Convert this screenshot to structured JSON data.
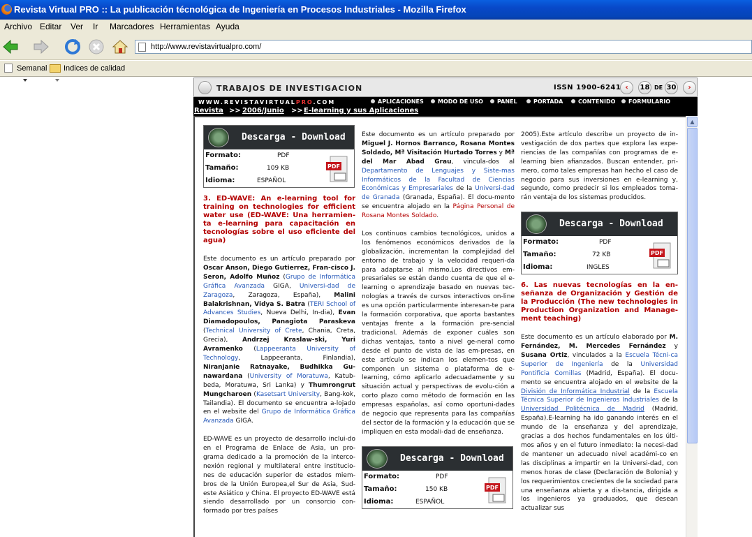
{
  "window": {
    "title": "Revista Virtual PRO :: La publicación técnológica de Ingeniería en Procesos Industriales - Mozilla Firefox"
  },
  "menu": [
    "Archivo",
    "Editar",
    "Ver",
    "Ir",
    "Marcadores",
    "Herramientas",
    "Ayuda"
  ],
  "address": {
    "url": "http://www.revistavirtualpro.com/"
  },
  "bookmarks": [
    "Semanal",
    "Indices de calidad"
  ],
  "site": {
    "section": "TRABAJOS DE INVESTIGACION",
    "issn": "ISSN 1900-6241",
    "page": "18",
    "of": "DE",
    "total": "30",
    "www": "WWW.REVISTAVIRTUAL",
    "pro": "PRO",
    ".com": ".COM",
    "nav": [
      "APLICACIONES",
      "MODO DE USO",
      "PANEL",
      "PORTADA",
      "CONTENIDO",
      "FORMULARIO"
    ],
    "crumb1": "Revista",
    "crumb2": "2006/Junio",
    "crumb3": "E-learning y sus Aplicaciones",
    "sep": ">>"
  },
  "download": {
    "header": "Descarga - Download",
    "fmt_label": "Formato:",
    "size_label": "Tamaño:",
    "lang_label": "Idioma:",
    "pdf": "PDF",
    "box1": {
      "size": "109 KB",
      "lang": "ESPAÑOL"
    },
    "box2": {
      "size": "72 KB",
      "lang": "INGLES"
    },
    "box3": {
      "size": "150 KB",
      "lang": "ESPAÑOL"
    }
  },
  "col1": {
    "h": "3. ED-WAVE: An e-learning tool for training on technologies for efficient water use (ED-WAVE: Una herramien-ta e-learning para capacitación en tecnologías sobre el uso eficiente del agua)",
    "p2": "ED-WAVE es un proyecto de desarrollo inclui-do en el Programa de Enlace de Asia, un pro-grama dedicado a la promoción de la interco-nexión regional y multilateral entre institucio-nes de educación superior de estados miem-bros de la Unión Europea,el Sur de Asia, Sud-este Asiático y China. El proyecto ED-WAVE está siendo desarrollado por un consorcio con-formado por tres países"
  },
  "col2": {
    "p2": "Los continuos cambios tecnológicos, unidos a los fenómenos económicos derivados de la globalización, incrementan la complejidad del entorno de trabajo y la velocidad requeri-da para adaptarse al mismo.Los directivos em-presariales se están dando cuenta de que el e-learning o aprendizaje basado en nuevas tec-nologías a través de cursos interactivos on-line es una opción particularmente interesan-te para la formación corporativa, que aporta bastantes ventajas frente a la formación pre-sencial tradicional. Además de exponer cuáles son dichas ventajas, tanto a nivel ge-neral como desde el punto de vista de las em-presas, en este artículo se indican los elemen-tos que componen un sistema o plataforma de e-learning, cómo aplicarlo adecuadamente y su situación actual y perspectivas de evolu-ción a corto plazo como método de formación en las empresas españolas, así como oportuni-dades de negocio que representa para las compañías del sector de la formación y la educación que se impliquen en esta modali-dad de enseñanza."
  },
  "col3": {
    "p1": "2005).Este artículo describe un proyecto de in-vestigación de dos partes que explora las expe-riencias de las compañías con programas de e-learning bien afianzados. Buscan entender, pri-mero, como tales empresas han hecho el caso de negocio para sus inversiones en e-learning y, segundo, como predecir si los empleados toma-rán ventaja de los sistemas producidos.",
    "h": "6. Las nuevas tecnologías en la en-señanza de Organización y Gestión de la Producción (The new technologies in Production Organization and Manage-ment teaching)"
  }
}
